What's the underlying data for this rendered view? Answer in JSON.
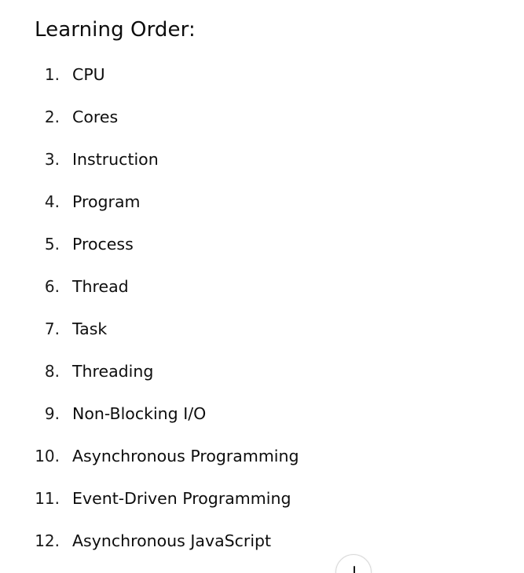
{
  "heading": "Learning Order:",
  "steps": [
    {
      "num": "1.",
      "label": "CPU"
    },
    {
      "num": "2.",
      "label": "Cores"
    },
    {
      "num": "3.",
      "label": "Instruction"
    },
    {
      "num": "4.",
      "label": "Program"
    },
    {
      "num": "5.",
      "label": "Process"
    },
    {
      "num": "6.",
      "label": "Thread"
    },
    {
      "num": "7.",
      "label": "Task"
    },
    {
      "num": "8.",
      "label": "Threading"
    },
    {
      "num": "9.",
      "label": "Non-Blocking I/O"
    },
    {
      "num": "10.",
      "label": "Asynchronous Programming"
    },
    {
      "num": "11.",
      "label": "Event-Driven Programming"
    },
    {
      "num": "12.",
      "label": "Asynchronous JavaScript"
    }
  ],
  "scroll_button": {
    "icon": "arrow-down-icon"
  }
}
